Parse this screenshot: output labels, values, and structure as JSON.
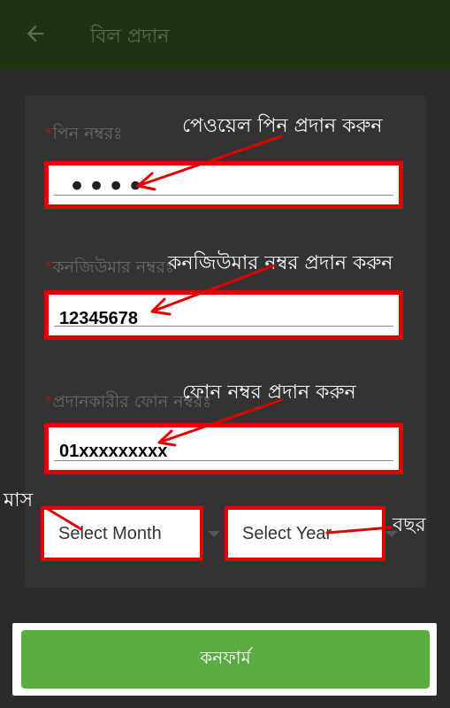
{
  "appbar": {
    "title": "বিল প্রদান",
    "back_icon": "arrow-left-icon"
  },
  "form": {
    "pin": {
      "label": "পিন নম্বরঃ",
      "value": "••••"
    },
    "consumer": {
      "label": "কনজিউমার নম্বরঃ",
      "value": "12345678"
    },
    "phone": {
      "label": "প্রদানকারীর ফোন নম্বরঃ",
      "value": "01xxxxxxxxx"
    },
    "month": {
      "value": "Select Month"
    },
    "year": {
      "value": "Select Year"
    },
    "required_mark": "*"
  },
  "annotations": {
    "pin_note": "পেওয়েল পিন প্রদান করুন",
    "consumer_note": "কনজিউমার নম্বর প্রদান করুন",
    "phone_note": "ফোন নম্বর প্রদান করুন",
    "month_note": "মাস",
    "year_note": "বছর"
  },
  "confirm_button": {
    "label": "কনফার্ম",
    "color": "#5aac43"
  },
  "colors": {
    "appbar": "#1e3311",
    "highlight": "#e10000"
  }
}
